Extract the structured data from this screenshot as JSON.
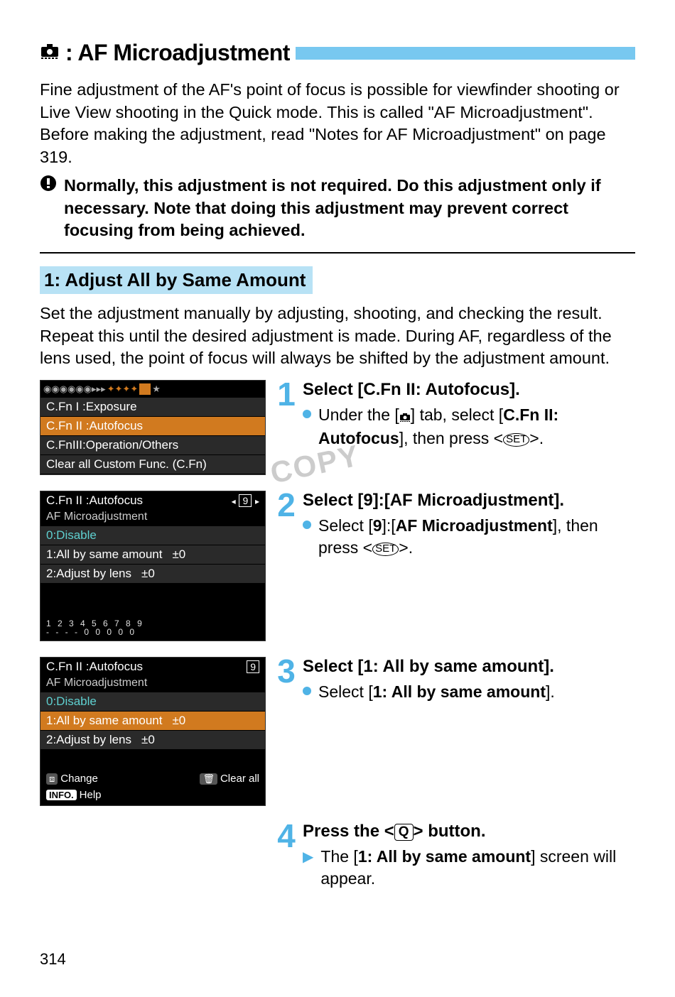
{
  "title": ": AF Microadjustment",
  "intro": "Fine adjustment of the AF's point of focus is possible for viewfinder shooting or Live View shooting in the Quick mode. This is called \"AF Microadjustment\". Before making the adjustment, read \"Notes for AF Microadjustment\" on page 319.",
  "warning": "Normally, this adjustment is not required. Do this adjustment only if necessary. Note that doing this adjustment may prevent correct focusing from being achieved.",
  "section1_title": "1: Adjust All by Same Amount",
  "section1_body": "Set the adjustment manually by adjusting, shooting, and checking the result. Repeat this until the desired adjustment is made. During AF, regardless of the lens used, the point of focus will always be shifted by the adjustment amount.",
  "steps": [
    {
      "num": "1",
      "heading": "Select [C.Fn II: Autofocus].",
      "bullet_pre": "Under the [",
      "bullet_mid": "] tab, select [",
      "bullet_bold1": "C.Fn II: Autofocus",
      "bullet_post1": "], then press <",
      "bullet_post2": ">."
    },
    {
      "num": "2",
      "heading": "Select [9]:[AF Microadjustment].",
      "bullet_pre": "Select [",
      "bullet_bold1": "9",
      "bullet_mid": "]:[",
      "bullet_bold2": "AF Microadjustment",
      "bullet_post1": "], then press <",
      "bullet_post2": ">."
    },
    {
      "num": "3",
      "heading": "Select [1: All by same amount].",
      "bullet_pre": "Select [",
      "bullet_bold1": "1: All by same amount",
      "bullet_post": "]."
    },
    {
      "num": "4",
      "heading_pre": "Press the <",
      "heading_post": "> button.",
      "arrow_pre": "The [",
      "arrow_bold": "1: All by same amount",
      "arrow_post": "] screen will appear."
    }
  ],
  "lcd1": {
    "r1": "C.Fn I :Exposure",
    "r2": "C.Fn II :Autofocus",
    "r3": "C.FnIII:Operation/Others",
    "r4": "Clear all Custom Func. (C.Fn)"
  },
  "lcd2": {
    "header": "C.Fn II :Autofocus",
    "badge": "9",
    "sub": "AF Microadjustment",
    "o0": "0:Disable",
    "o1": "1:All by same amount",
    "o1v": "±0",
    "o2": "2:Adjust by lens",
    "o2v": "±0",
    "digits1": "1 2 3 4 5 6 7 8 9",
    "digits2": "- - - - 0 0 0 0 0"
  },
  "lcd3": {
    "header": "C.Fn II :Autofocus",
    "badge": "9",
    "sub": "AF Microadjustment",
    "o0": "0:Disable",
    "o1": "1:All by same amount",
    "o1v": "±0",
    "o2": "2:Adjust by lens",
    "o2v": "±0",
    "f_change": "Change",
    "f_clear": "Clear all",
    "f_help": "Help",
    "f_info": "INFO."
  },
  "page_number": "314",
  "watermark": "COPY"
}
